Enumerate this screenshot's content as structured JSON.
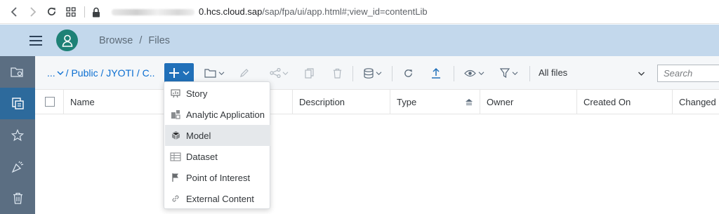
{
  "browser": {
    "url_host": "0.hcs.cloud.sap",
    "url_path": "/sap/fpa/ui/app.html#;view_id=contentLib"
  },
  "shell": {
    "breadcrumb": [
      "Browse",
      "Files"
    ],
    "brand_color": "#1e8176"
  },
  "toolbar": {
    "path": {
      "ellipsis": "...",
      "separator": "/",
      "segments": [
        "Public",
        "JYOTI",
        "C.."
      ]
    },
    "filter_label": "All files",
    "search_placeholder": "Search",
    "accent_color": "#2170b9"
  },
  "table": {
    "columns": [
      "Name",
      "Description",
      "Type",
      "Owner",
      "Created On",
      "Changed"
    ]
  },
  "new_menu": {
    "items": [
      {
        "label": "Story",
        "icon": "story-icon"
      },
      {
        "label": "Analytic Application",
        "icon": "analytic-application-icon"
      },
      {
        "label": "Model",
        "icon": "model-icon",
        "hovered": true
      },
      {
        "label": "Dataset",
        "icon": "dataset-icon"
      },
      {
        "label": "Point of Interest",
        "icon": "flag-icon"
      },
      {
        "label": "External Content",
        "icon": "link-icon"
      }
    ]
  },
  "rail": {
    "items": [
      {
        "icon": "settings-folder-icon"
      },
      {
        "icon": "my-files-icon",
        "active": true
      },
      {
        "icon": "favorites-star-icon"
      },
      {
        "icon": "featured-icon"
      },
      {
        "icon": "trash-icon"
      }
    ]
  }
}
